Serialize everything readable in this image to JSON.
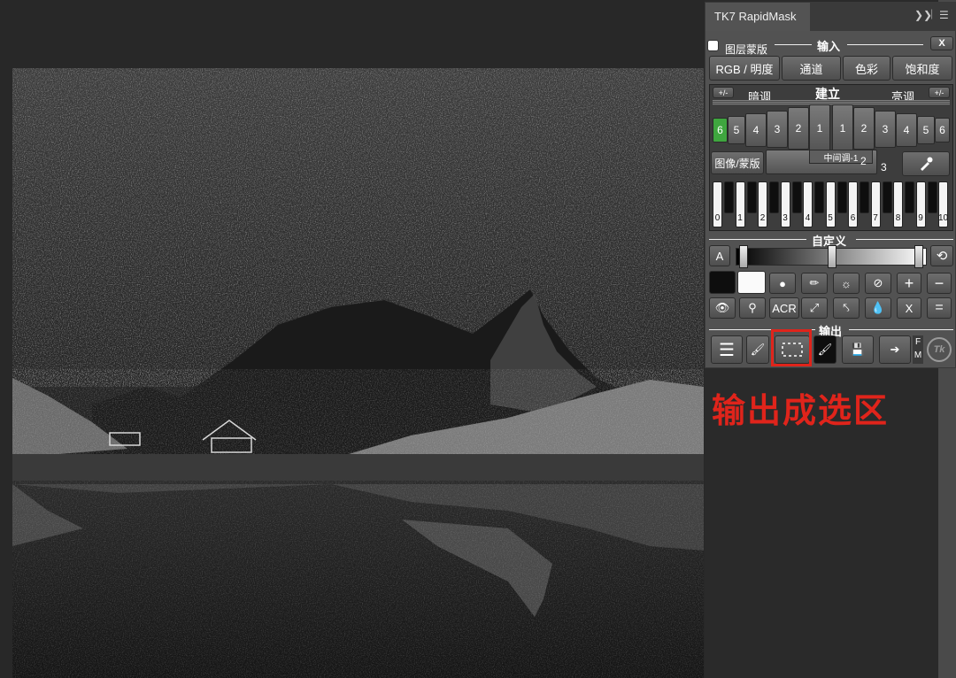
{
  "panel": {
    "title": "TK7 RapidMask",
    "expand_icon": "double-chevron-right",
    "menu_icon": "hamburger"
  },
  "input_section": {
    "layer_mask_checkbox_label": "图层蒙版",
    "title": "输入",
    "close_label": "X",
    "buttons": [
      "RGB / 明度",
      "通道",
      "色彩",
      "饱和度"
    ]
  },
  "build_section": {
    "toggle_left": "+/-",
    "darks_label": "暗调",
    "title": "建立",
    "lights_label": "亮调",
    "toggle_right": "+/-",
    "dark_zones": [
      "6",
      "5",
      "4",
      "3",
      "2",
      "1"
    ],
    "light_zones": [
      "1",
      "2",
      "3",
      "4",
      "5",
      "6"
    ],
    "midtone_label": "中间调-1",
    "midtone_zones": [
      "2",
      "3"
    ],
    "image_mask_button": "图像/蒙版",
    "eyedropper_icon": "eyedropper",
    "zone_keys": [
      "0",
      "1",
      "2",
      "3",
      "4",
      "5",
      "6",
      "7",
      "8",
      "9",
      "10"
    ]
  },
  "custom_section": {
    "title": "自定义",
    "a_button": "A",
    "reset_icon": "reset",
    "row1_icons": [
      "black-swatch",
      "white-swatch",
      "circle-mask",
      "curves",
      "brightness",
      "no-adjust",
      "plus",
      "minus"
    ],
    "row2_labels": [
      "eye",
      "magnify",
      "ACR",
      "expand",
      "contract",
      "drop",
      "X",
      "="
    ]
  },
  "output_section": {
    "title": "输出",
    "fm_label_f": "F",
    "fm_label_m": "M",
    "logo_text": "Tk"
  },
  "annotation": {
    "text": "输出成选区",
    "color": "#e0241b"
  },
  "colors": {
    "panel_bg": "#525252",
    "active_zone": "#3fa63f",
    "annotation_red": "#e0241b"
  }
}
